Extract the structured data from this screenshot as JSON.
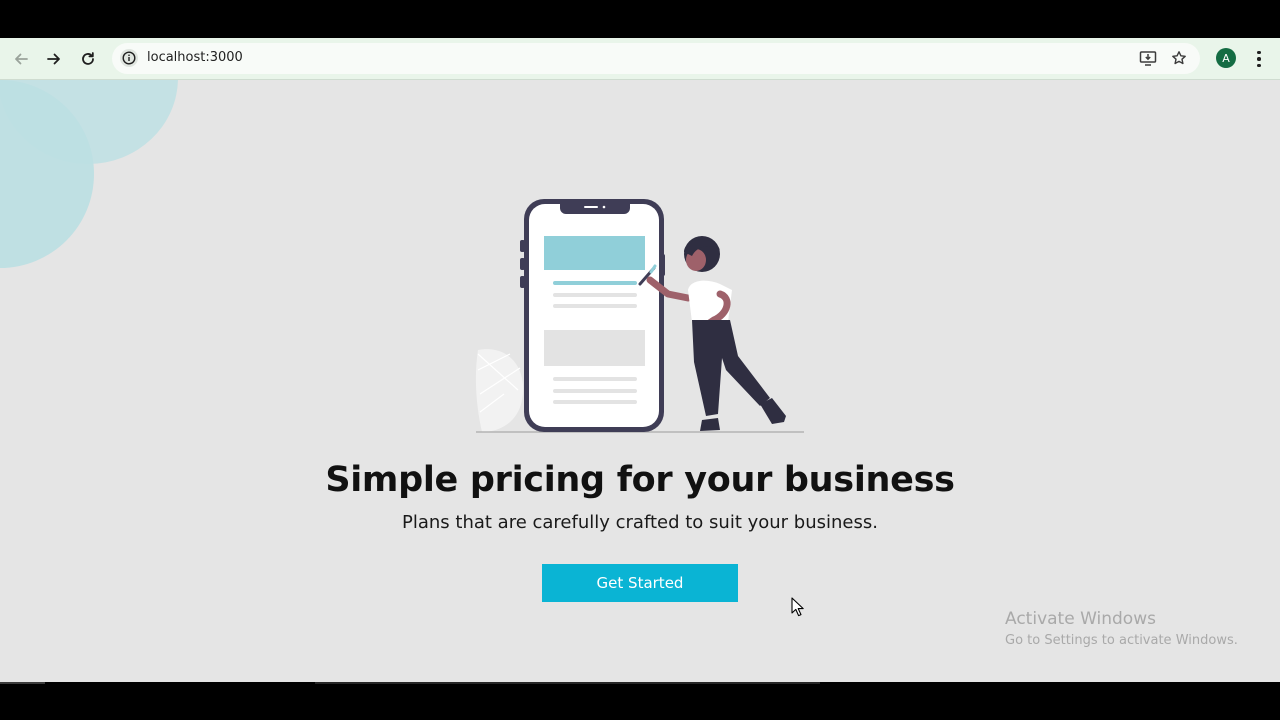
{
  "browser": {
    "url": "localhost:3000",
    "profile_initial": "A",
    "icons": {
      "back": "back-arrow-icon",
      "forward": "forward-arrow-icon",
      "reload": "reload-icon",
      "site_info": "info-icon",
      "install": "install-app-icon",
      "bookmark": "star-icon",
      "menu": "kebab-menu-icon"
    },
    "colors": {
      "toolbar_bg": "#e9f5ea",
      "avatar_bg": "#146c43"
    }
  },
  "hero": {
    "headline": "Simple pricing for your business",
    "subtitle": "Plans that are carefully crafted to suit your business.",
    "cta_label": "Get Started",
    "illustration": "person-with-phone-illustration",
    "colors": {
      "cta_bg": "#0ab4d4",
      "page_bg": "#e5e5e5",
      "accent_shapes": "#c4e1e4"
    }
  },
  "watermark": {
    "line1": "Activate Windows",
    "line2": "Go to Settings to activate Windows."
  }
}
